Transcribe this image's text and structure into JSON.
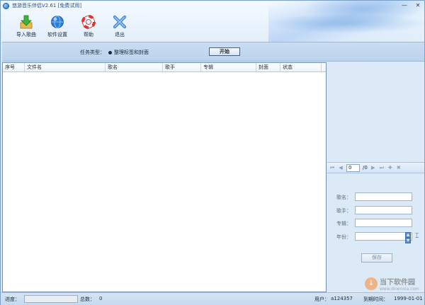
{
  "window": {
    "title": "悠游音乐伴侣V2.61  [免费试用]",
    "controls": {
      "minimize": "—",
      "close": "✕"
    }
  },
  "toolbar": {
    "items": [
      {
        "label": "导入歌曲",
        "icon": "import-arrow-icon"
      },
      {
        "label": "软件设置",
        "icon": "settings-globe-icon"
      },
      {
        "label": "帮助",
        "icon": "lifebuoy-help-icon"
      },
      {
        "label": "退出",
        "icon": "exit-x-icon"
      }
    ]
  },
  "task": {
    "label": "任务类型：",
    "option": "整理标签和封面",
    "start_label": "开始"
  },
  "table": {
    "columns": [
      "序号",
      "文件名",
      "歌名",
      "歌手",
      "专辑",
      "封面",
      "状态"
    ],
    "rows": []
  },
  "pager": {
    "current": "0",
    "total": "/0"
  },
  "form": {
    "title_label": "歌名：",
    "artist_label": "歌手：",
    "album_label": "专辑：",
    "year_label": "年份：",
    "title_value": "",
    "artist_value": "",
    "album_value": "",
    "year_value": "",
    "save_label": "保存"
  },
  "status": {
    "progress_label": "进度：",
    "progress_fraction": 0,
    "total_label": "总数：",
    "total_value": "0",
    "user_label": "用户：",
    "user_value": "a124357",
    "expire_label": "到期时间：",
    "expire_value": "1999-01-01"
  },
  "watermark": {
    "cn": "当下软件园",
    "en": "www.downxia.com"
  },
  "colors": {
    "window_bg": "#dce9f7",
    "accent": "#1f6fc4",
    "progress": "#6fb0f2"
  }
}
